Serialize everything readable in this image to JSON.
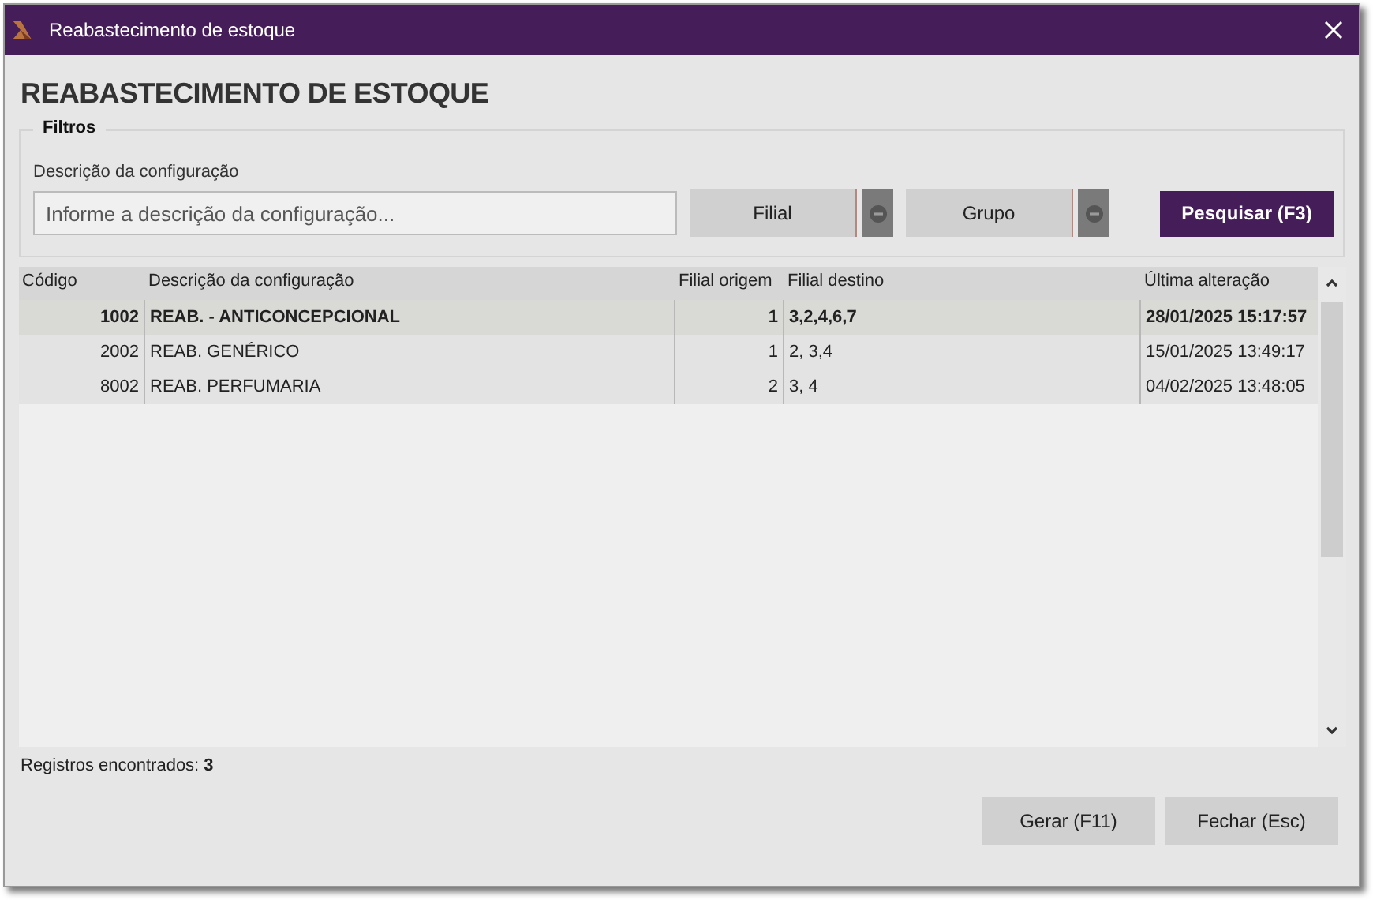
{
  "window": {
    "title": "Reabastecimento de estoque"
  },
  "heading": "REABASTECIMENTO DE ESTOQUE",
  "filters": {
    "legend": "Filtros",
    "field_label": "Descrição da configuração",
    "placeholder": "Informe a descrição da configuração...",
    "selectors": [
      "Filial",
      "Grupo"
    ],
    "search_button": "Pesquisar (F3)"
  },
  "table": {
    "columns": [
      "Código",
      "Descrição da configuração",
      "Filial origem",
      "Filial destino",
      "Última alteração"
    ],
    "rows": [
      {
        "cells": [
          "1002",
          "REAB. - ANTICONCEPCIONAL",
          "1",
          "3,2,4,6,7",
          "28/01/2025 15:17:57"
        ],
        "selected": true
      },
      {
        "cells": [
          "2002",
          "REAB. GENÉRICO",
          "1",
          "2, 3,4",
          "15/01/2025 13:49:17"
        ],
        "selected": false
      },
      {
        "cells": [
          "8002",
          "REAB. PERFUMARIA",
          "2",
          "3, 4",
          "04/02/2025 13:48:05"
        ],
        "selected": false
      }
    ]
  },
  "records": "Registros encontrados: **3**",
  "buttons": [
    "Gerar (F11)",
    "Fechar (Esc)"
  ]
}
